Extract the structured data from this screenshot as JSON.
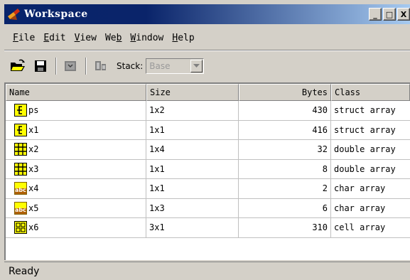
{
  "window": {
    "title": "Workspace",
    "buttons": {
      "minimize": "_",
      "maximize": "□",
      "close": "X"
    }
  },
  "menu": [
    {
      "label": "File",
      "key": "F",
      "rest": "ile"
    },
    {
      "label": "Edit",
      "key": "E",
      "rest": "dit"
    },
    {
      "label": "View",
      "key": "V",
      "rest": "iew"
    },
    {
      "label": "Web",
      "pre": "We",
      "key": "b"
    },
    {
      "label": "Window",
      "key": "W",
      "rest": "indow"
    },
    {
      "label": "Help",
      "key": "H",
      "rest": "elp"
    }
  ],
  "toolbar": {
    "stack_label": "Stack:",
    "stack_value": "Base"
  },
  "table": {
    "headers": {
      "name": "Name",
      "size": "Size",
      "bytes": "Bytes",
      "class": "Class"
    },
    "rows": [
      {
        "icon": "struct-icon",
        "name": "ps",
        "size": "1x2",
        "bytes": "430",
        "class": "struct array"
      },
      {
        "icon": "struct-icon",
        "name": "x1",
        "size": "1x1",
        "bytes": "416",
        "class": "struct array"
      },
      {
        "icon": "double-grid-icon",
        "name": "x2",
        "size": "1x4",
        "bytes": "32",
        "class": "double array"
      },
      {
        "icon": "double-grid-icon",
        "name": "x3",
        "size": "1x1",
        "bytes": "8",
        "class": "double array"
      },
      {
        "icon": "abc-icon",
        "name": "x4",
        "size": "1x1",
        "bytes": "2",
        "class": "char array"
      },
      {
        "icon": "abc-icon",
        "name": "x5",
        "size": "1x3",
        "bytes": "6",
        "class": "char array"
      },
      {
        "icon": "cell-icon",
        "name": "x6",
        "size": "3x1",
        "bytes": "310",
        "class": "cell array"
      }
    ]
  },
  "status": "Ready",
  "colors": {
    "titlebar_start": "#0a246a",
    "titlebar_end": "#a6caf0",
    "icon_yellow": "#ffff00"
  }
}
